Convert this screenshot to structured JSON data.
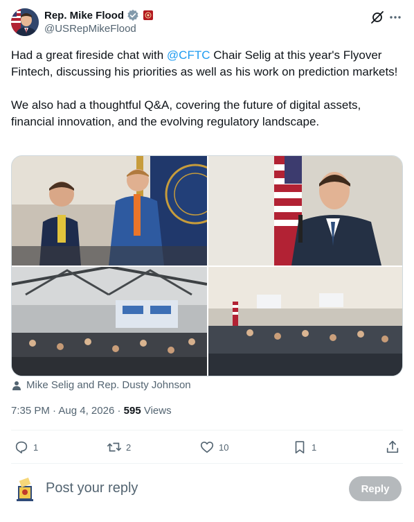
{
  "author": {
    "display_name": "Rep. Mike Flood",
    "handle": "@USRepMikeFlood",
    "avatar_icon": "profile-photo",
    "verified_icon": "verified-badge-icon",
    "affiliation_icon": "us-house-seal-icon"
  },
  "header": {
    "grok_icon": "grok-icon",
    "more_icon": "more-icon"
  },
  "tweet": {
    "line1_before": "Had a great fireside chat with ",
    "mention": "@CFTC",
    "line1_after": " Chair Selig at this year's Flyover Fintech, discussing his priorities as well as his work on prediction markets!",
    "paragraph2": "We also had a thoughtful Q&A, covering the future of digital assets, financial innovation, and the evolving regulatory landscape."
  },
  "tagged_users": "Mike Selig and Rep. Dusty Johnson",
  "meta": {
    "time": "7:35 PM",
    "separator": " · ",
    "date": "Aug 4, 2026",
    "views_count": "595",
    "views_label": " Views"
  },
  "actions": {
    "replies": "1",
    "reposts": "2",
    "likes": "10",
    "bookmarks": "1"
  },
  "reply_bar": {
    "placeholder": "Post your reply",
    "button_label": "Reply"
  },
  "colors": {
    "accent": "#1d9bf0",
    "text": "#0f1419",
    "secondary": "#536471",
    "border": "#cfd9de"
  }
}
